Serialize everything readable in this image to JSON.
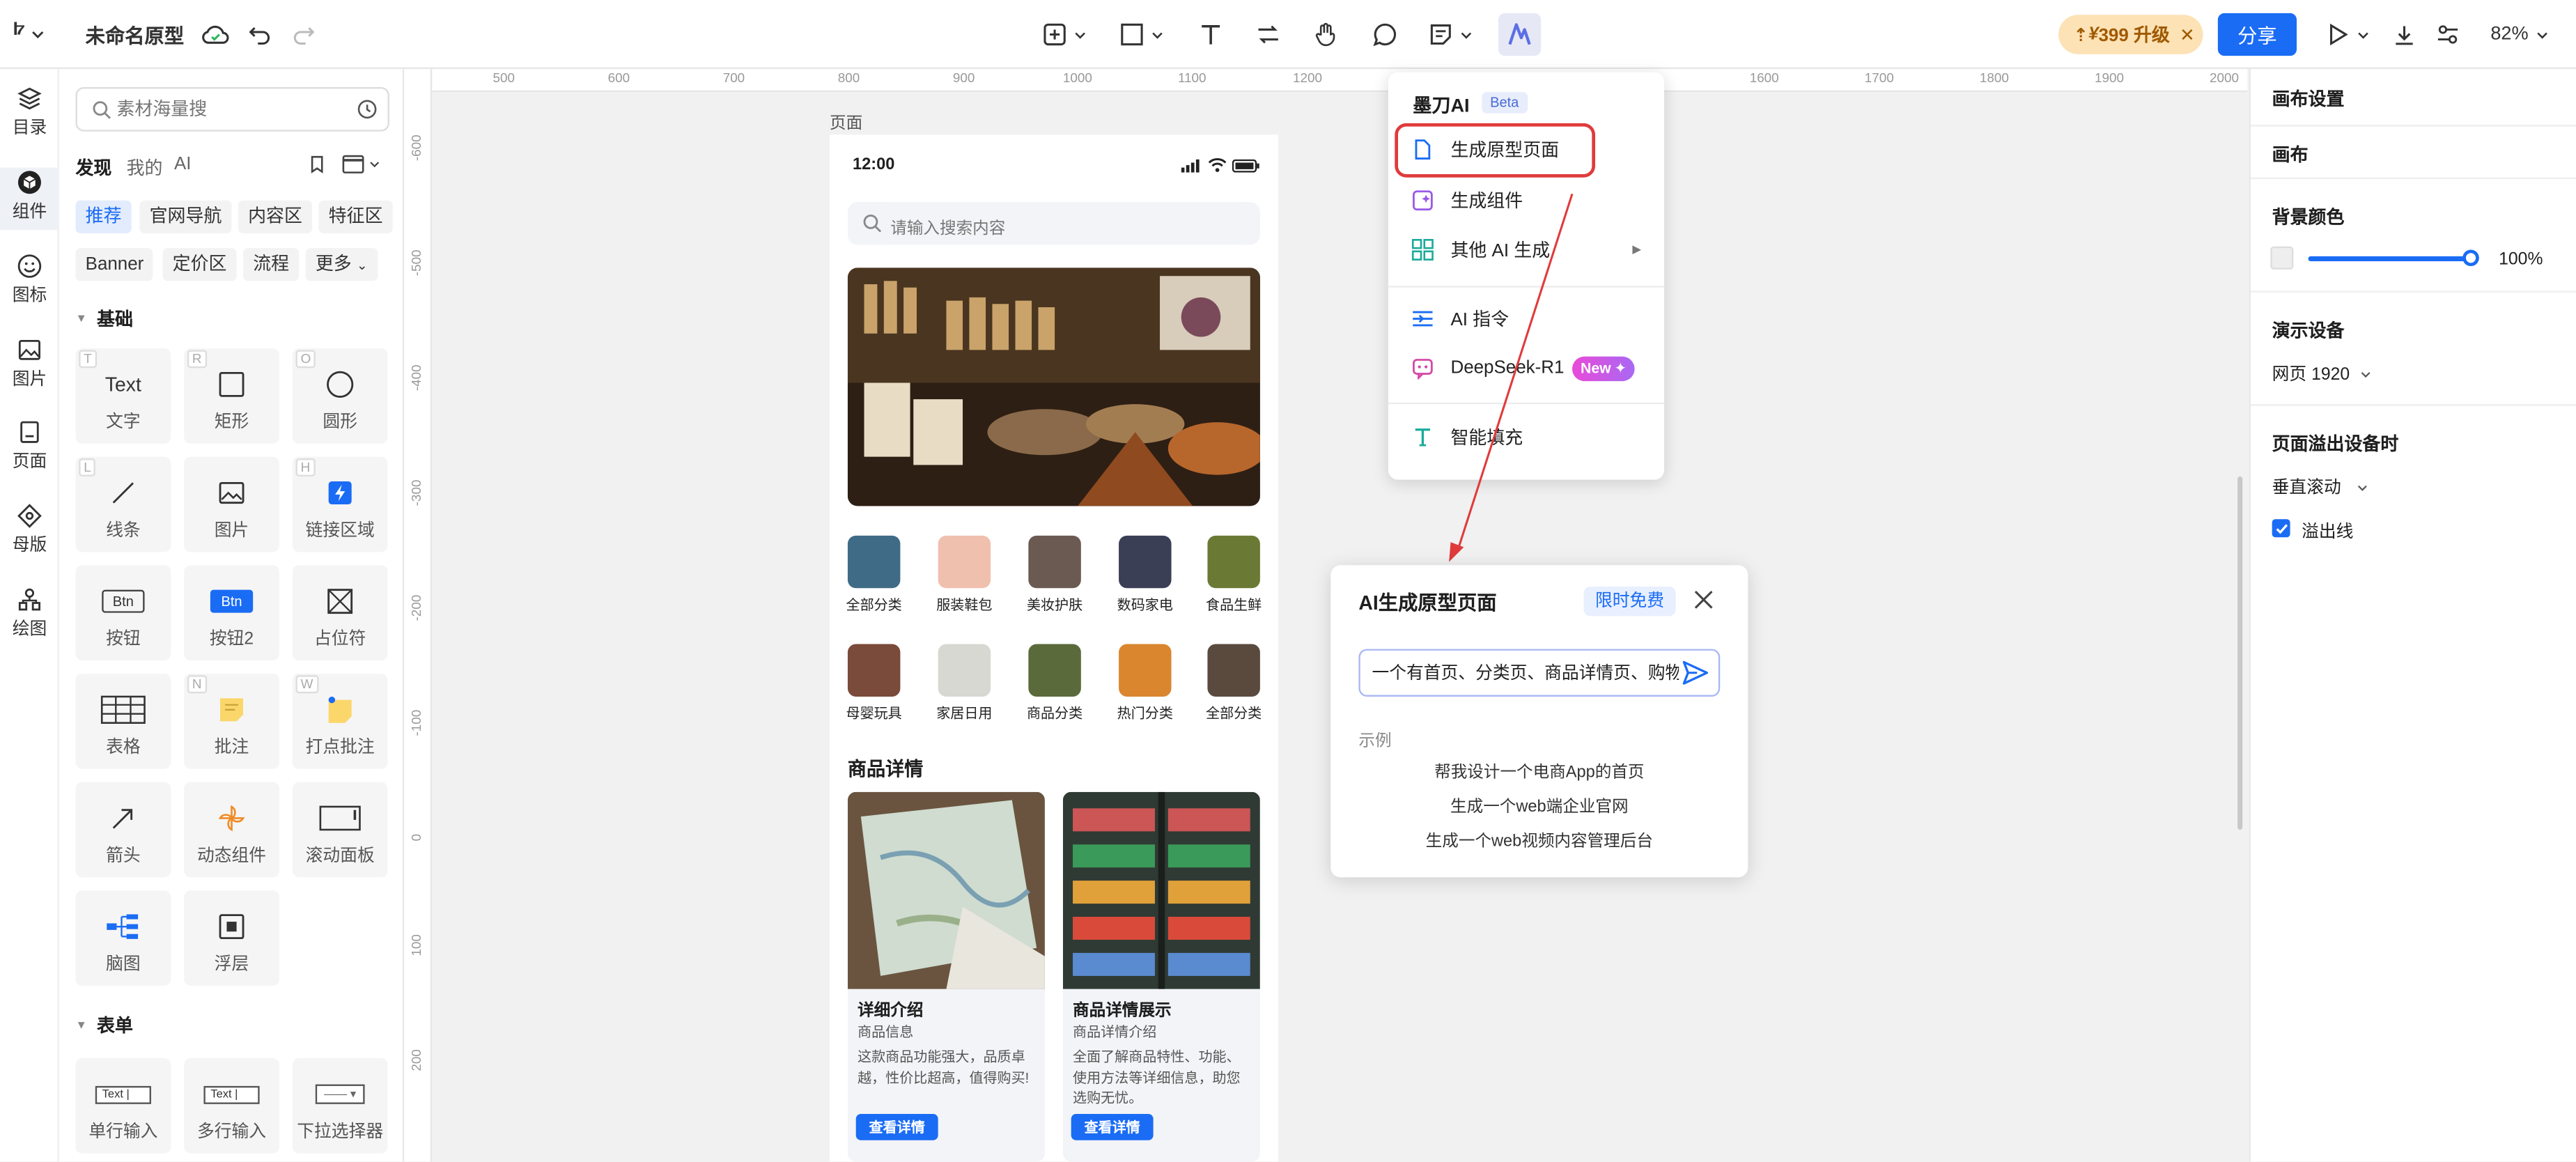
{
  "topbar": {
    "doc_title": "未命名原型",
    "upgrade_label": "399 升级",
    "share_label": "分享",
    "zoom": "82%"
  },
  "leftnav": {
    "items": [
      {
        "label": "目录",
        "icon": "layers-icon"
      },
      {
        "label": "组件",
        "icon": "cube-icon"
      },
      {
        "label": "图标",
        "icon": "smile-icon"
      },
      {
        "label": "图片",
        "icon": "image-icon"
      },
      {
        "label": "页面",
        "icon": "page-icon"
      },
      {
        "label": "母版",
        "icon": "master-icon"
      },
      {
        "label": "绘图",
        "icon": "draw-icon"
      }
    ]
  },
  "panel": {
    "search_placeholder": "素材海量搜",
    "tabs": [
      "发现",
      "我的",
      "AI"
    ],
    "chips_row1": [
      "推荐",
      "官网导航",
      "内容区",
      "特征区"
    ],
    "chips_row2": [
      "Banner",
      "定价区",
      "流程",
      "更多"
    ],
    "section_basic": "基础",
    "tiles": [
      {
        "label": "文字",
        "key": "T",
        "glyph": "Text"
      },
      {
        "label": "矩形",
        "key": "R"
      },
      {
        "label": "圆形",
        "key": "O"
      },
      {
        "label": "线条",
        "key": "L"
      },
      {
        "label": "图片"
      },
      {
        "label": "链接区域",
        "key": "H"
      },
      {
        "label": "按钮",
        "glyph": "Btn"
      },
      {
        "label": "按钮2",
        "glyph": "Btn"
      },
      {
        "label": "占位符"
      },
      {
        "label": "表格"
      },
      {
        "label": "批注",
        "key": "N"
      },
      {
        "label": "打点批注",
        "key": "W"
      },
      {
        "label": "箭头"
      },
      {
        "label": "动态组件"
      },
      {
        "label": "滚动面板"
      },
      {
        "label": "脑图"
      },
      {
        "label": "浮层"
      }
    ],
    "section_form": "表单",
    "form_tiles": [
      {
        "label": "单行输入",
        "glyph": "Text |"
      },
      {
        "label": "多行输入",
        "glyph": "Text |"
      },
      {
        "label": "下拉选择器",
        "glyph": "—— ▾"
      }
    ]
  },
  "ruler": {
    "top": [
      "500",
      "600",
      "700",
      "800",
      "900",
      "1000",
      "1100",
      "1200",
      "1600",
      "1700",
      "1800",
      "1900",
      "2000"
    ],
    "left": [
      "-600",
      "-500",
      "-400",
      "-300",
      "-200",
      "-100",
      "0",
      "100",
      "200"
    ]
  },
  "canvas": {
    "page_label": "页面"
  },
  "phone": {
    "time": "12:00",
    "search_placeholder": "请输入搜索内容",
    "categories_row1": [
      "全部分类",
      "服装鞋包",
      "美妆护肤",
      "数码家电",
      "食品生鲜"
    ],
    "categories_row2": [
      "母婴玩具",
      "家居日用",
      "商品分类",
      "热门分类",
      "全部分类"
    ],
    "section_title": "商品详情",
    "cards": [
      {
        "title": "详细介绍",
        "subtitle": "商品信息",
        "desc": "这款商品功能强大，品质卓越，性价比超高，值得购买!",
        "button": "查看详情"
      },
      {
        "title": "商品详情展示",
        "subtitle": "商品详情介绍",
        "desc": "全面了解商品特性、功能、使用方法等详细信息，助您选购无忧。",
        "button": "查看详情"
      }
    ]
  },
  "ai_menu": {
    "title": "墨刀AI",
    "badge": "Beta",
    "items": [
      {
        "label": "生成原型页面"
      },
      {
        "label": "生成组件"
      },
      {
        "label": "其他 AI 生成"
      },
      {
        "label": "AI 指令"
      },
      {
        "label": "DeepSeek-R1",
        "badge": "New"
      },
      {
        "label": "智能填充"
      }
    ]
  },
  "ai_dialog": {
    "title": "AI生成原型页面",
    "badge": "限时免费",
    "input_value": "一个有首页、分类页、商品详情页、购物",
    "examples_label": "示例",
    "examples": [
      "帮我设计一个电商App的首页",
      "生成一个web端企业官网",
      "生成一个web视频内容管理后台"
    ]
  },
  "rightpanel": {
    "title": "画布设置",
    "subtitle": "画布",
    "bg_label": "背景颜色",
    "opacity": "100%",
    "opacity_value": 1.0,
    "device_label": "演示设备",
    "device_value": "网页 1920",
    "overflow_label": "页面溢出设备时",
    "scroll_value": "垂直滚动",
    "overflow_line_label": "溢出线",
    "overflow_line_checked": true
  },
  "colors": {
    "accent": "#1a6cf5",
    "highlight": "#e03b3b",
    "upgrade_bg": "#fde2b6",
    "new_badge": "#e84bd8"
  }
}
